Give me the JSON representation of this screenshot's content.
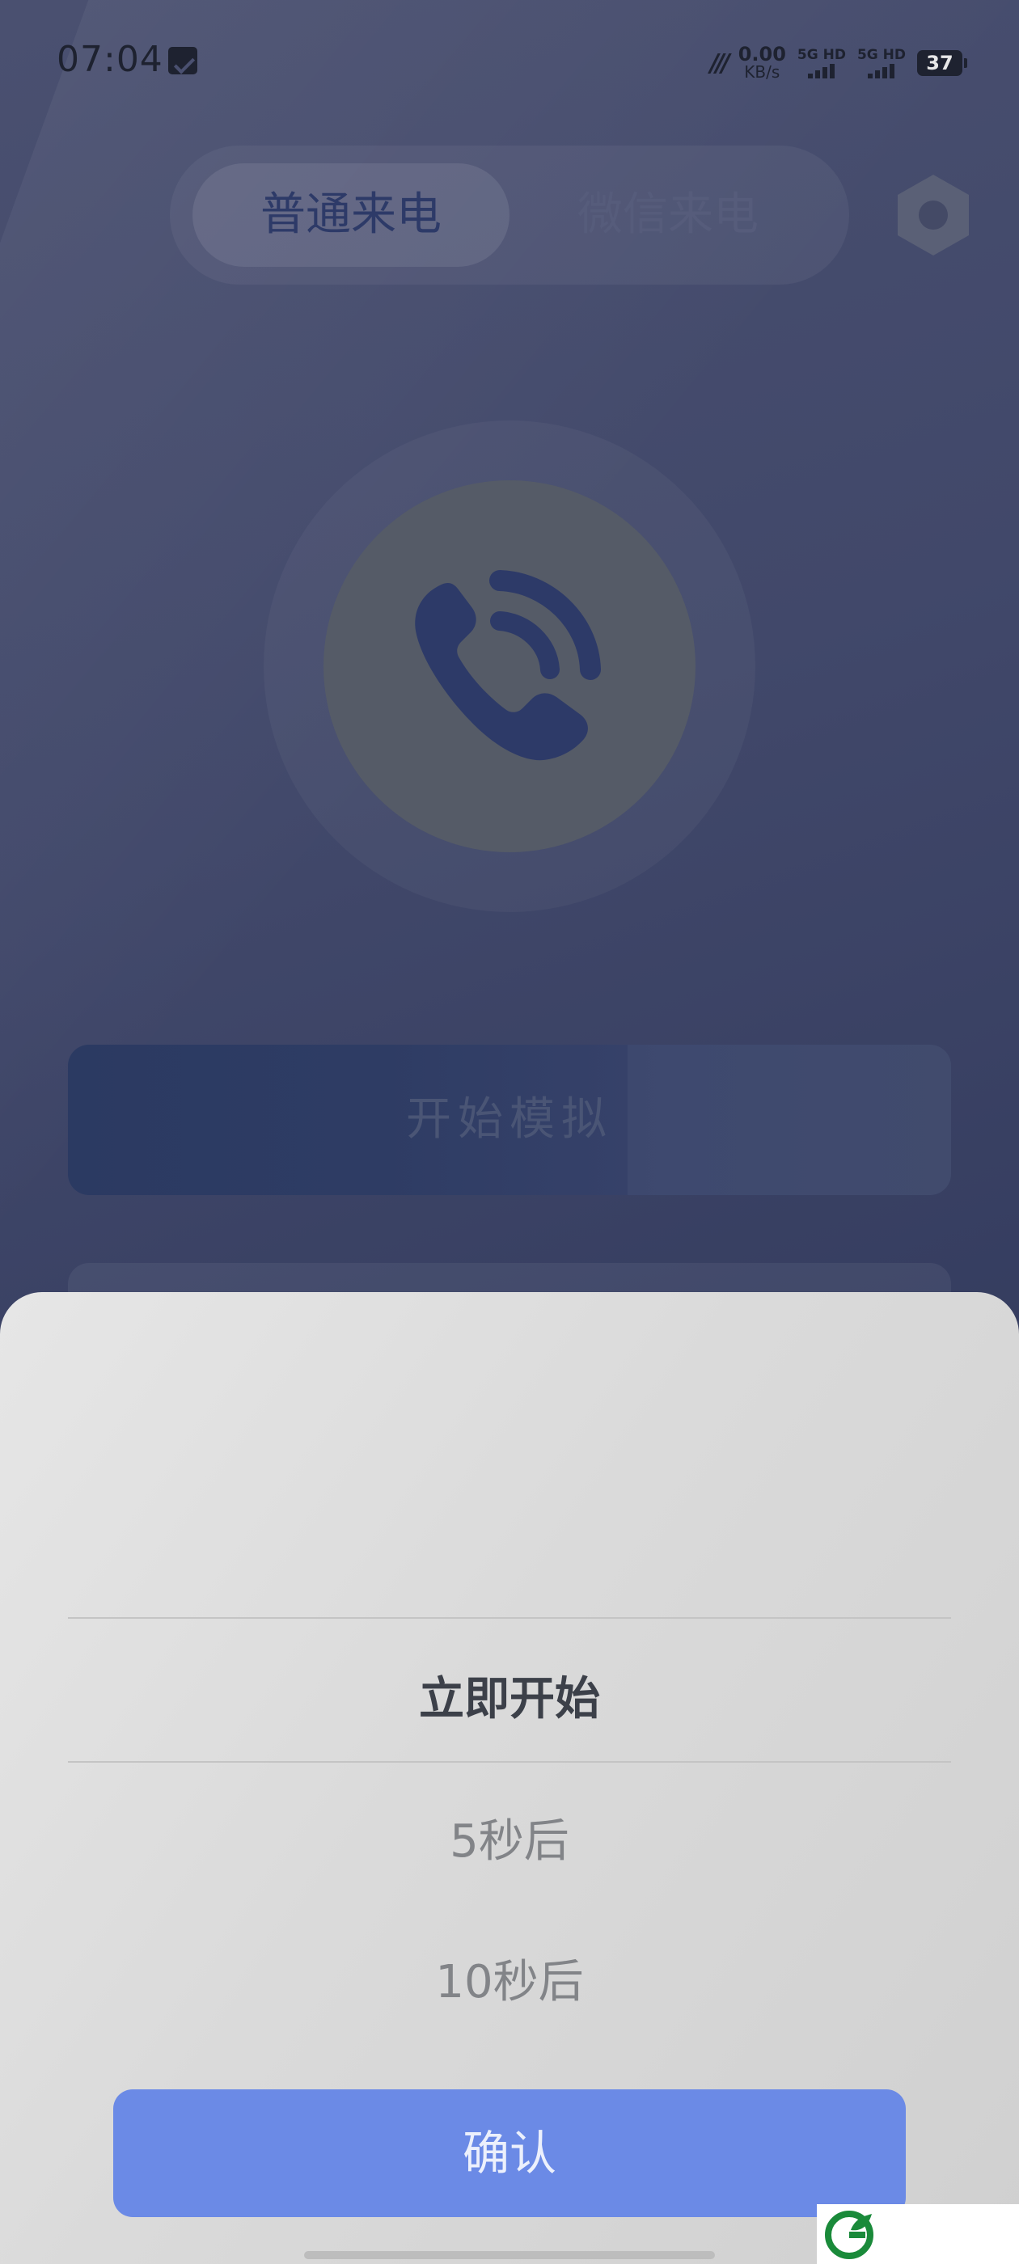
{
  "status_bar": {
    "time": "07:04",
    "nfc": "NFC",
    "net_speed_value": "0.00",
    "net_speed_unit": "KB/s",
    "sim1_label": "5G HD",
    "sim2_label": "5G HD",
    "battery": "37"
  },
  "tabs": [
    {
      "label": "普通来电",
      "active": true
    },
    {
      "label": "微信来电",
      "active": false
    }
  ],
  "icons": {
    "settings": "settings-hex-icon",
    "call": "phone-ringing-icon"
  },
  "start_button_label": "开始模拟",
  "picker": {
    "selected": "立即开始",
    "options": [
      "5秒后",
      "10秒后"
    ]
  },
  "confirm_label": "确认",
  "colors": {
    "accent": "#6b8ae6",
    "phone_icon": "#2d3a68"
  }
}
